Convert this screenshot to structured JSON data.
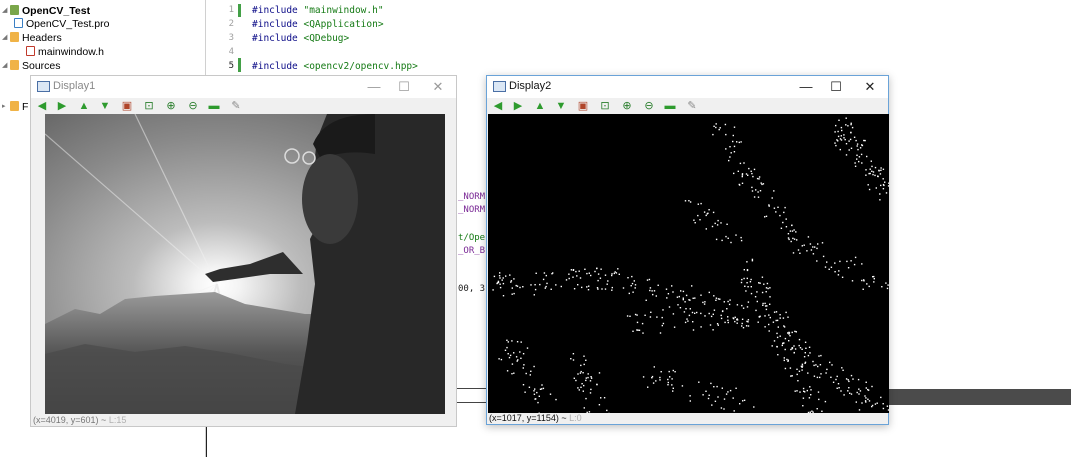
{
  "tree": {
    "project": "OpenCV_Test",
    "pro_file": "OpenCV_Test.pro",
    "headers": "Headers",
    "header_file": "mainwindow.h",
    "sources": "Sources",
    "partial_f": "F"
  },
  "editor": {
    "lines": [
      {
        "no": "1",
        "pre": "#include ",
        "arg": "\"mainwindow.h\""
      },
      {
        "no": "2",
        "pre": "#include ",
        "arg": "<QApplication>"
      },
      {
        "no": "3",
        "pre": "#include ",
        "arg": "<QDebug>"
      },
      {
        "no": "4",
        "pre": "",
        "arg": ""
      },
      {
        "no": "5",
        "pre": "#include ",
        "arg": "<opencv2/opencv.hpp>"
      }
    ],
    "fragments": {
      "norm1": "_NORM",
      "norm2": "_NORM",
      "ope": "t/Ope",
      "orb": "_OR_B",
      "num": "00, 3"
    }
  },
  "display1": {
    "title": "Display1",
    "status_coords": "(x=4019, y=601) ~",
    "status_value": "L:15"
  },
  "display2": {
    "title": "Display2",
    "status_coords": "(x=1017, y=1154) ~",
    "status_value": "L:0"
  },
  "window_controls": {
    "minimize": "—",
    "maximize": "☐",
    "close": "✕"
  },
  "toolbar_icons": [
    "arrow-left-icon",
    "arrow-right-icon",
    "arrow-up-icon",
    "arrow-down-icon",
    "image-icon",
    "zoom-fit-icon",
    "zoom-in-icon",
    "zoom-out-icon",
    "save-icon",
    "properties-icon"
  ],
  "colors": {
    "accent_border": "#6aa3d8",
    "toolbar_green": "#2e9b2e",
    "modified_marker": "#43a047"
  }
}
